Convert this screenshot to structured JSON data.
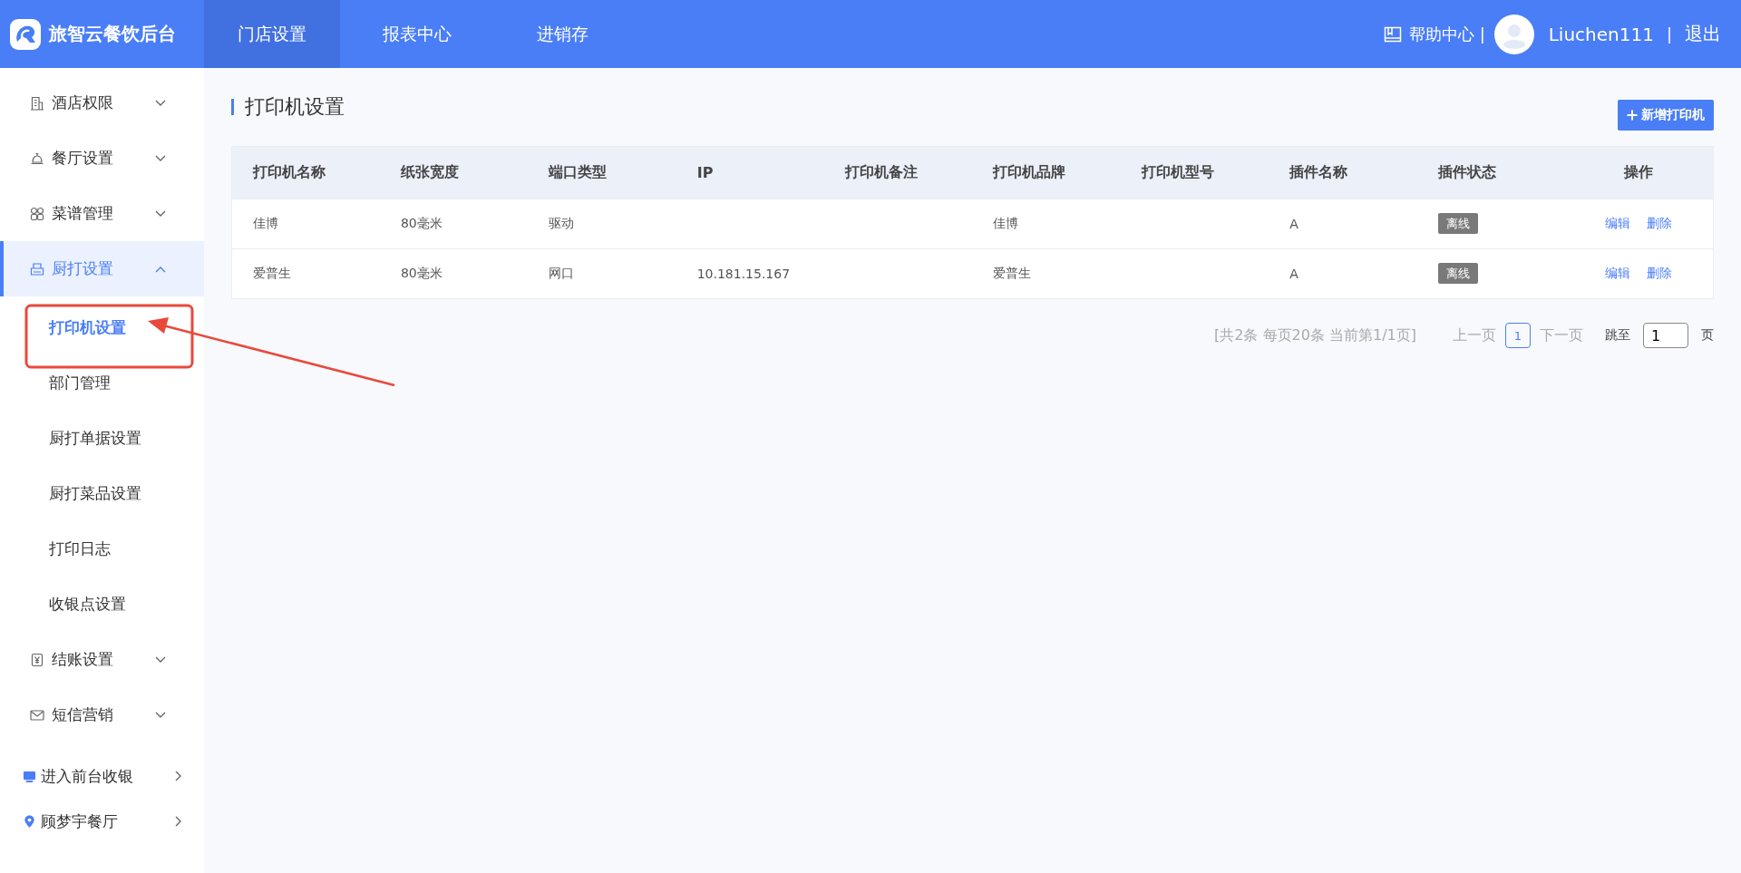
{
  "header": {
    "logo": "旅智云餐饮后台",
    "nav": [
      {
        "label": "门店设置",
        "selected": true
      },
      {
        "label": "报表中心",
        "selected": false
      },
      {
        "label": "进销存",
        "selected": false
      }
    ],
    "help": "帮助中心",
    "separator_1": "|",
    "user": "Liuchen111",
    "separator_2": "|",
    "logout": "退出"
  },
  "sidebar": {
    "items": [
      {
        "label": "酒店权限",
        "kind": "building",
        "expanded": false
      },
      {
        "label": "餐厅设置",
        "kind": "bell",
        "expanded": false
      },
      {
        "label": "菜谱管理",
        "kind": "grid",
        "expanded": false
      },
      {
        "label": "厨打设置",
        "kind": "printer",
        "expanded": true,
        "children": [
          {
            "label": "打印机设置",
            "selected": true
          },
          {
            "label": "部门管理",
            "selected": false
          },
          {
            "label": "厨打单据设置",
            "selected": false
          },
          {
            "label": "厨打菜品设置",
            "selected": false
          },
          {
            "label": "打印日志",
            "selected": false
          },
          {
            "label": "收银点设置",
            "selected": false
          }
        ]
      },
      {
        "label": "结账设置",
        "kind": "yen",
        "expanded": false
      },
      {
        "label": "短信营销",
        "kind": "mail",
        "expanded": false
      }
    ],
    "links": [
      {
        "label": "进入前台收银",
        "kind": "monitor"
      },
      {
        "label": "顾梦宇餐厅",
        "kind": "pin"
      }
    ]
  },
  "page": {
    "title": "打印机设置",
    "add_button": "新增打印机",
    "table": {
      "columns": [
        "打印机名称",
        "纸张宽度",
        "端口类型",
        "IP",
        "打印机备注",
        "打印机品牌",
        "打印机型号",
        "插件名称",
        "插件状态",
        "操作"
      ],
      "rows": [
        {
          "cells": [
            "佳博",
            "80毫米",
            "驱动",
            "",
            "",
            "佳博",
            "",
            "A"
          ],
          "status": "离线",
          "actions": [
            "编辑",
            "删除"
          ]
        },
        {
          "cells": [
            "爱普生",
            "80毫米",
            "网口",
            "10.181.15.167",
            "",
            "爱普生",
            "",
            "A"
          ],
          "status": "离线",
          "actions": [
            "编辑",
            "删除"
          ]
        }
      ]
    },
    "pagination": {
      "summary": "[共2条 每页20条 当前第1/1页]",
      "prev": "上一页",
      "pages": [
        {
          "label": "1",
          "selected": true
        }
      ],
      "next": "下一页",
      "jump_label": "跳至",
      "jump_value": "1",
      "unit": "页"
    }
  }
}
